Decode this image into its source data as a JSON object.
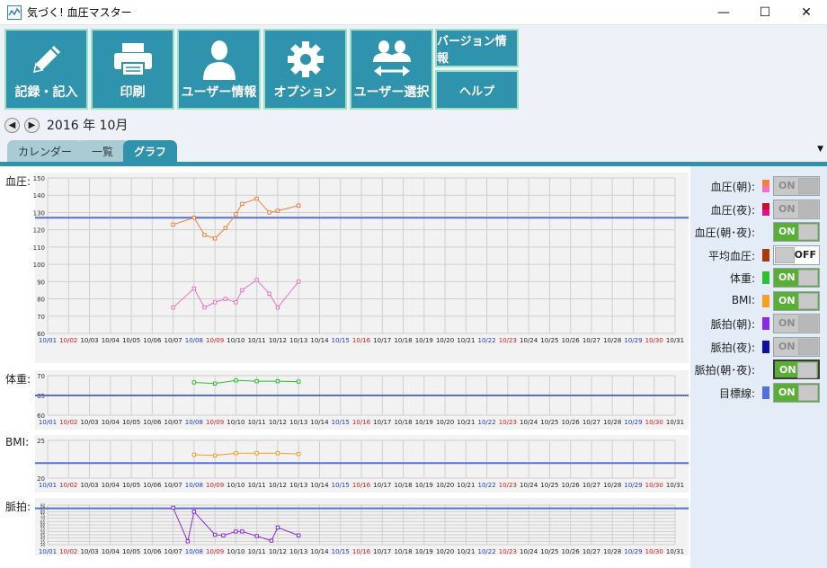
{
  "window": {
    "title": "気づく! 血圧マスター",
    "minimize": "—",
    "maximize": "☐",
    "close": "✕"
  },
  "toolbar": {
    "buttons": [
      {
        "label": "記録・記入",
        "icon": "pencil-icon"
      },
      {
        "label": "印刷",
        "icon": "printer-icon"
      },
      {
        "label": "ユーザー情報",
        "icon": "user-icon"
      },
      {
        "label": "オプション",
        "icon": "gear-icon"
      },
      {
        "label": "ユーザー選択",
        "icon": "user-switch-icon"
      }
    ],
    "version_label": "バージョン情報",
    "help_label": "ヘルプ"
  },
  "month_nav": {
    "year": "2016",
    "year_unit": "年",
    "month": "10",
    "month_unit": "月"
  },
  "tabs": [
    {
      "label": "カレンダー"
    },
    {
      "label": "一覧"
    },
    {
      "label": "グラフ"
    }
  ],
  "colors": {
    "accent": "#2f93ad",
    "accent_border": "#9ee0c6",
    "target_line": "#5570d8",
    "toggle_on": "#59ae36"
  },
  "dates": [
    "10/01",
    "10/02",
    "10/03",
    "10/04",
    "10/05",
    "10/06",
    "10/07",
    "10/08",
    "10/09",
    "10/10",
    "10/11",
    "10/12",
    "10/13",
    "10/14",
    "10/15",
    "10/16",
    "10/17",
    "10/18",
    "10/19",
    "10/20",
    "10/21",
    "10/22",
    "10/23",
    "10/24",
    "10/25",
    "10/26",
    "10/27",
    "10/28",
    "10/29",
    "10/30",
    "10/31"
  ],
  "date_colors": [
    "#1a3fd0",
    "#d81c1c",
    "#222",
    "#222",
    "#222",
    "#222",
    "#222",
    "#1a3fd0",
    "#d81c1c",
    "#222",
    "#222",
    "#222",
    "#222",
    "#222",
    "#1a3fd0",
    "#d81c1c",
    "#222",
    "#222",
    "#222",
    "#222",
    "#222",
    "#1a3fd0",
    "#d81c1c",
    "#222",
    "#222",
    "#222",
    "#222",
    "#222",
    "#1a3fd0",
    "#d81c1c",
    "#222"
  ],
  "chart_data": [
    {
      "type": "line",
      "title": "血圧:",
      "ylim": [
        60,
        150
      ],
      "yticks": [
        60,
        70,
        80,
        90,
        100,
        110,
        120,
        130,
        140,
        150
      ],
      "target": 127,
      "grid": true,
      "series": [
        {
          "color": "#f08040",
          "points": [
            [
              6,
              123
            ],
            [
              7,
              127
            ],
            [
              7.5,
              117
            ],
            [
              8,
              115
            ],
            [
              8.5,
              121
            ],
            [
              9,
              129
            ],
            [
              9.3,
              135
            ],
            [
              10,
              138
            ],
            [
              10.6,
              130
            ],
            [
              11,
              131
            ],
            [
              12,
              134
            ]
          ]
        },
        {
          "color": "#f070c8",
          "points": [
            [
              6,
              75
            ],
            [
              7,
              86
            ],
            [
              7.5,
              75
            ],
            [
              8,
              78
            ],
            [
              8.5,
              80
            ],
            [
              9,
              78
            ],
            [
              9.3,
              85
            ],
            [
              10,
              91
            ],
            [
              10.6,
              83
            ],
            [
              11,
              75
            ],
            [
              12,
              90
            ]
          ]
        }
      ]
    },
    {
      "type": "line",
      "title": "体重:",
      "ylim": [
        60,
        70
      ],
      "yticks": [
        60,
        65,
        70
      ],
      "target": 65,
      "grid": true,
      "series": [
        {
          "color": "#2ec02e",
          "points": [
            [
              7,
              68.3
            ],
            [
              8,
              68
            ],
            [
              9,
              68.8
            ],
            [
              10,
              68.6
            ],
            [
              11,
              68.6
            ],
            [
              12,
              68.5
            ]
          ]
        }
      ]
    },
    {
      "type": "line",
      "title": "BMI:",
      "ylim": [
        20,
        25
      ],
      "yticks": [
        20,
        25
      ],
      "target": 22,
      "grid": true,
      "series": [
        {
          "color": "#f4a020",
          "points": [
            [
              7,
              23.1
            ],
            [
              8,
              23.0
            ],
            [
              9,
              23.3
            ],
            [
              10,
              23.3
            ],
            [
              11,
              23.3
            ],
            [
              12,
              23.2
            ]
          ]
        }
      ]
    },
    {
      "type": "line",
      "title": "脈拍:",
      "ylim": [
        30,
        90
      ],
      "yticks": [
        30,
        35,
        40,
        45,
        50,
        55,
        60,
        65,
        70,
        75,
        80,
        85,
        90
      ],
      "target": 85,
      "grid": true,
      "series": [
        {
          "color": "#8a2be2",
          "points": [
            [
              6,
              86
            ],
            [
              6.7,
              35
            ],
            [
              7,
              80
            ],
            [
              8,
              45
            ],
            [
              8.4,
              44
            ],
            [
              9,
              50
            ],
            [
              9.3,
              50
            ],
            [
              10,
              43
            ],
            [
              10.7,
              36
            ],
            [
              11,
              56
            ],
            [
              12,
              44
            ]
          ]
        }
      ]
    }
  ],
  "legend": [
    {
      "label": "血圧(朝):",
      "colors": [
        "#f08040",
        "#f070c8"
      ],
      "state": "ON",
      "mode": "dim"
    },
    {
      "label": "血圧(夜):",
      "colors": [
        "#c0102a",
        "#e0108c"
      ],
      "state": "ON",
      "mode": "dim"
    },
    {
      "label": "血圧(朝･夜):",
      "colors": [],
      "state": "ON",
      "mode": "on"
    },
    {
      "label": "平均血圧:",
      "colors": [
        "#a83a10"
      ],
      "state": "OFF",
      "mode": "off"
    },
    {
      "label": "体重:",
      "colors": [
        "#2ec02e"
      ],
      "state": "ON",
      "mode": "on"
    },
    {
      "label": "BMI:",
      "colors": [
        "#f4a020"
      ],
      "state": "ON",
      "mode": "on"
    },
    {
      "label": "脈拍(朝):",
      "colors": [
        "#8a2be2"
      ],
      "state": "ON",
      "mode": "dim"
    },
    {
      "label": "脈拍(夜):",
      "colors": [
        "#1010a0"
      ],
      "state": "ON",
      "mode": "dim"
    },
    {
      "label": "脈拍(朝･夜):",
      "colors": [],
      "state": "ON",
      "mode": "on-focus"
    },
    {
      "label": "目標線:",
      "colors": [
        "#5570d8"
      ],
      "state": "ON",
      "mode": "on"
    }
  ]
}
